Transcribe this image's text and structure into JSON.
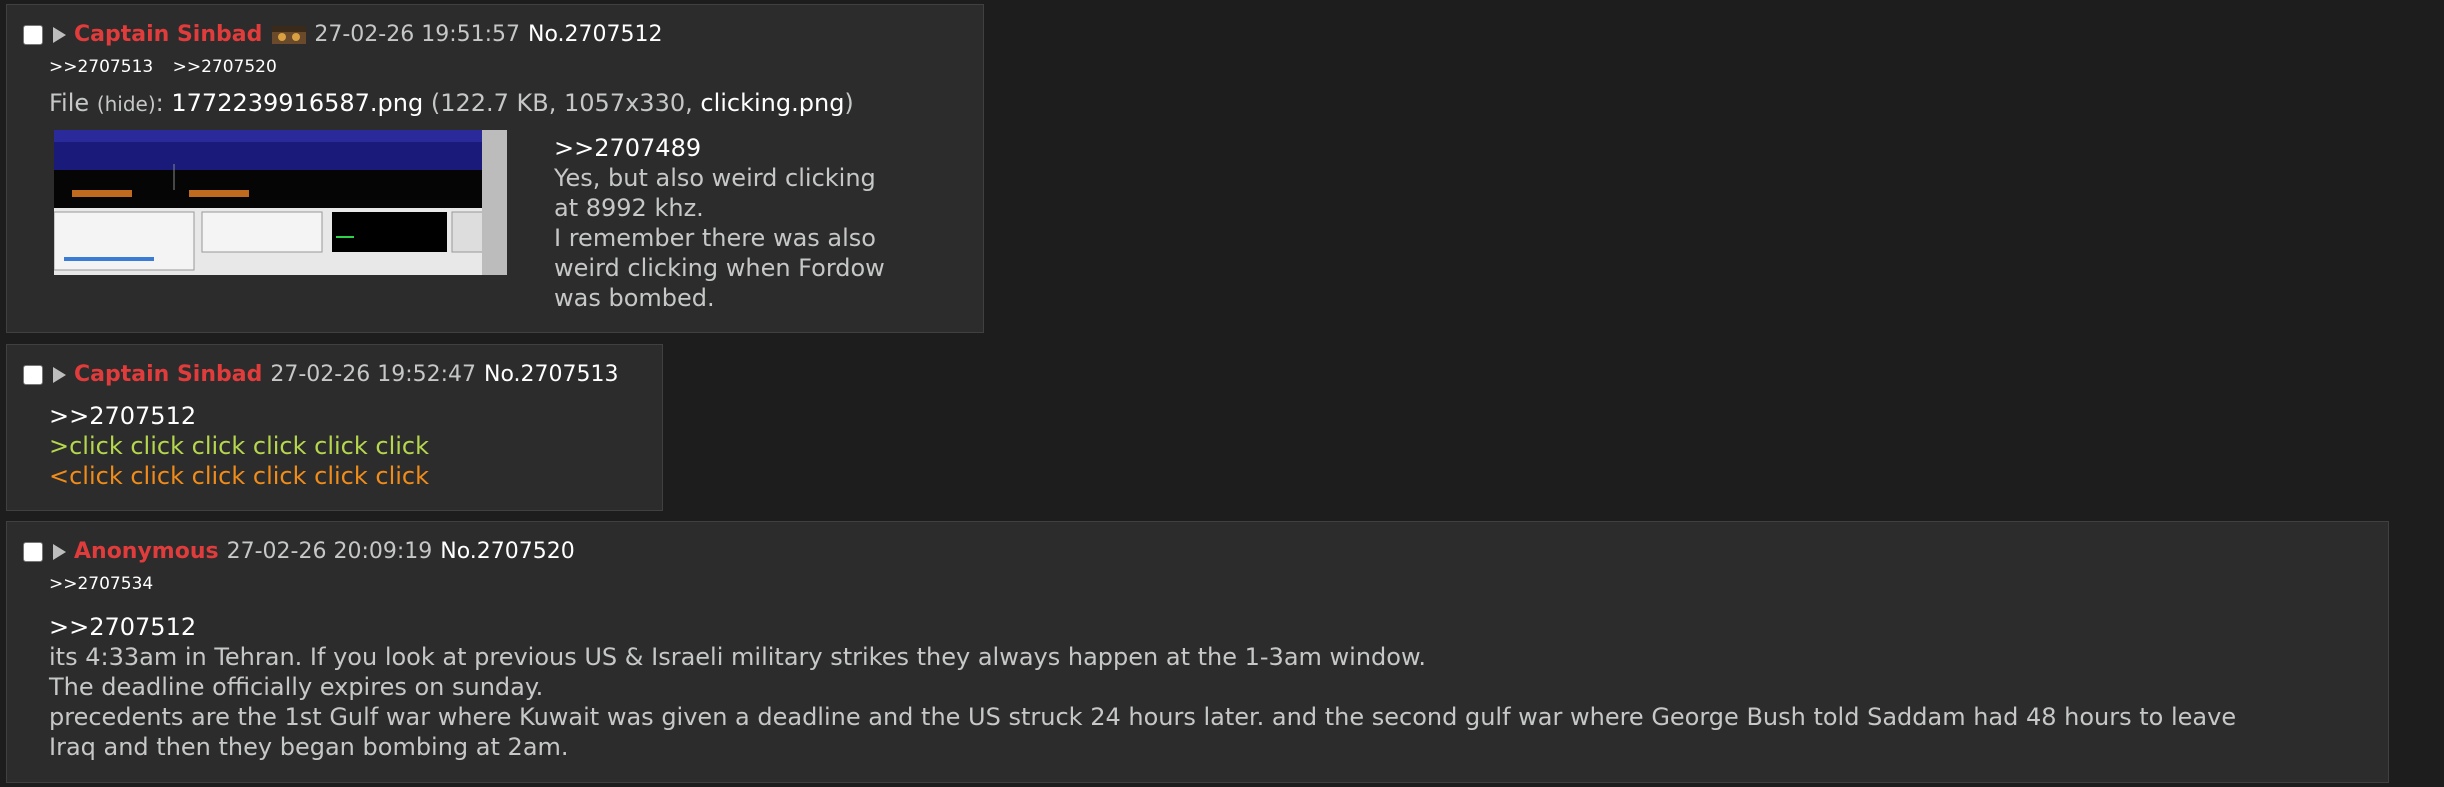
{
  "posts": [
    {
      "name": "Captain Sinbad",
      "date": "27-02-26 19:51:57",
      "no": "No.2707512",
      "backlinks": [
        ">>2707513",
        ">>2707520"
      ],
      "file": {
        "label": "File",
        "hide": "hide",
        "filename": "1772239916587.png",
        "size": "122.7 KB",
        "dims": "1057x330",
        "original": "clicking.png"
      },
      "body": [
        ">>2707489",
        "Yes, but also weird clicking",
        "at 8992 khz.",
        "I remember there was also",
        "weird clicking when Fordow",
        "was bombed."
      ]
    },
    {
      "name": "Captain Sinbad",
      "date": "27-02-26 19:52:47",
      "no": "No.2707513",
      "body": [
        ">>2707512",
        ">click click click click click click",
        "<click click click click click click"
      ]
    },
    {
      "name": "Anonymous",
      "date": "27-02-26 20:09:19",
      "no": "No.2707520",
      "backlinks": [
        ">>2707534"
      ],
      "body": [
        ">>2707512",
        "its 4:33am in Tehran. If you look at previous US & Israeli military strikes they always happen at the 1-3am window.",
        "The deadline officially expires on sunday.",
        "precedents are the 1st Gulf war where Kuwait was given a deadline and the US struck 24 hours later. and the second gulf war where George Bush told Saddam had 48 hours to leave",
        "Iraq and then they began bombing at 2am."
      ]
    }
  ]
}
